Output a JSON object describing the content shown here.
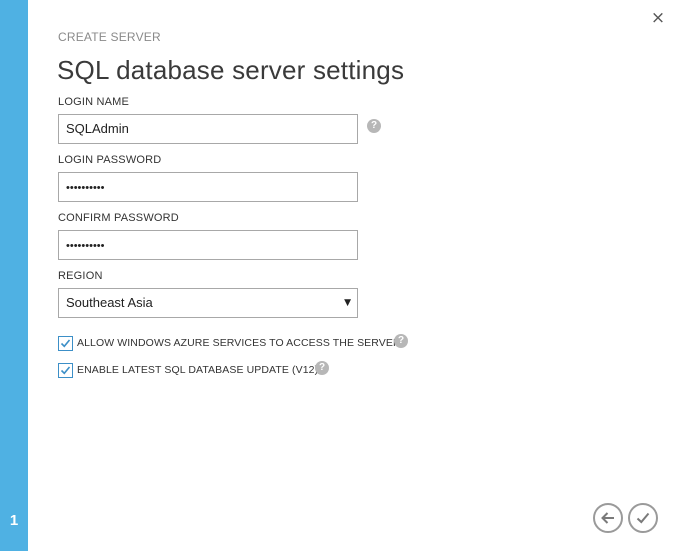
{
  "wizard": {
    "step": "1",
    "subheading": "CREATE SERVER",
    "title": "SQL database server settings"
  },
  "form": {
    "login_name_label": "LOGIN NAME",
    "login_name_value": "SQLAdmin",
    "login_password_label": "LOGIN PASSWORD",
    "login_password_masked": "••••••••••",
    "confirm_password_label": "CONFIRM PASSWORD",
    "confirm_password_masked": "••••••••••",
    "region_label": "REGION",
    "region_value": "Southeast Asia",
    "allow_azure_label": "ALLOW WINDOWS AZURE SERVICES TO ACCESS THE SERVER.",
    "allow_azure_checked": true,
    "enable_v12_label": "ENABLE LATEST SQL DATABASE UPDATE (V12)",
    "enable_v12_checked": true
  },
  "icons": {
    "help": "?",
    "close": "×",
    "dropdown": "▼"
  },
  "colors": {
    "accent": "#4fb1e3",
    "checkbox_border": "#3c8fc7",
    "help_icon": "#b7b7b7"
  }
}
